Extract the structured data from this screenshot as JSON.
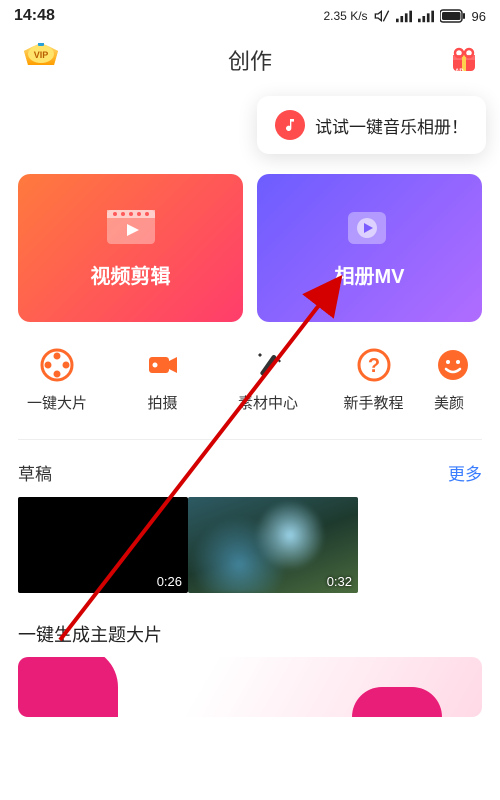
{
  "status": {
    "time": "14:48",
    "speed": "2.35",
    "speed_unit": "K/s",
    "battery": "96"
  },
  "header": {
    "title": "创作"
  },
  "tooltip": {
    "text": "试试一键音乐相册！"
  },
  "hero": {
    "left": "视频剪辑",
    "right": "相册MV"
  },
  "tools": [
    {
      "label": "一键大片"
    },
    {
      "label": "拍摄"
    },
    {
      "label": "素材中心"
    },
    {
      "label": "新手教程"
    },
    {
      "label": "美颜"
    }
  ],
  "draft_section": {
    "title": "草稿",
    "more": "更多"
  },
  "drafts": [
    {
      "time": "0:26"
    },
    {
      "time": "0:32"
    }
  ],
  "theme_section": {
    "title": "一键生成主题大片"
  }
}
